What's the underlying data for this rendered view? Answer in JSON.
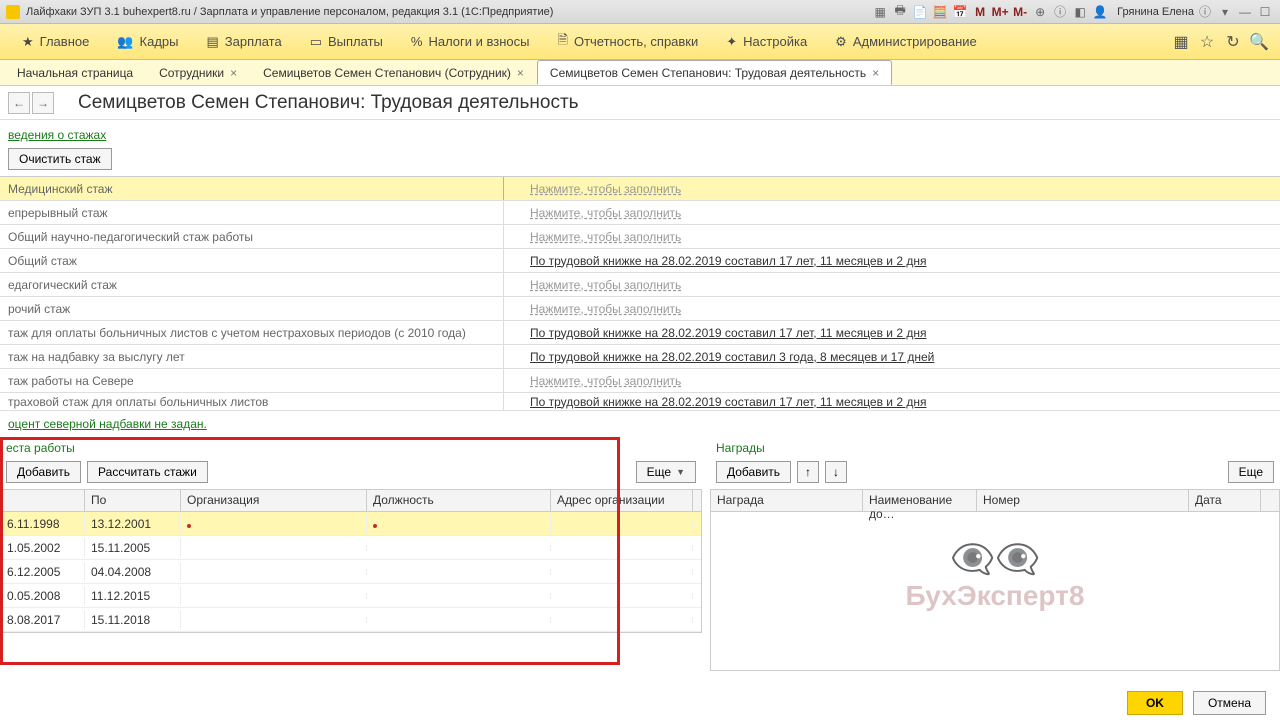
{
  "titlebar": {
    "title": "Лайфхаки ЗУП 3.1 buhexpert8.ru / Зарплата и управление персоналом, редакция 3.1  (1С:Предприятие)",
    "user": "Грянина Елена"
  },
  "menubar": {
    "items": [
      {
        "label": "Главное"
      },
      {
        "label": "Кадры"
      },
      {
        "label": "Зарплата"
      },
      {
        "label": "Выплаты"
      },
      {
        "label": "Налоги и взносы"
      },
      {
        "label": "Отчетность, справки"
      },
      {
        "label": "Настройка"
      },
      {
        "label": "Администрирование"
      }
    ]
  },
  "tabs": {
    "items": [
      {
        "label": "Начальная страница",
        "closable": false
      },
      {
        "label": "Сотрудники",
        "closable": true
      },
      {
        "label": "Семицветов Семен Степанович (Сотрудник)",
        "closable": true
      },
      {
        "label": "Семицветов Семен Степанович: Трудовая деятельность",
        "closable": true,
        "active": true
      }
    ]
  },
  "headline": "Семицветов Семен Степанович: Трудовая деятельность",
  "section1": {
    "title": "ведения о стажах",
    "clear_btn": "Очистить стаж"
  },
  "fill_placeholder": "Нажмите, чтобы заполнить",
  "stazh_rows": [
    {
      "label": "Медицинский стаж",
      "value": "",
      "selected": true
    },
    {
      "label": "епрерывный стаж",
      "value": ""
    },
    {
      "label": "Общий научно-педагогический стаж работы",
      "value": ""
    },
    {
      "label": "Общий стаж",
      "value": "По трудовой книжке на 28.02.2019 составил 17 лет, 11 месяцев и 2 дня"
    },
    {
      "label": "едагогический стаж",
      "value": ""
    },
    {
      "label": "рочий стаж",
      "value": ""
    },
    {
      "label": "таж для оплаты больничных листов с учетом нестраховых периодов (с 2010 года)",
      "value": "По трудовой книжке на 28.02.2019 составил 17 лет, 11 месяцев и 2 дня"
    },
    {
      "label": "таж на надбавку за выслугу лет",
      "value": "По трудовой книжке на 28.02.2019 составил 3 года, 8 месяцев и 17 дней"
    },
    {
      "label": "таж работы на Севере",
      "value": ""
    },
    {
      "label": "траховой стаж для оплаты больничных листов",
      "value": "По трудовой книжке на 28.02.2019 составил 17 лет, 11 месяцев и 2 дня"
    }
  ],
  "northern_link": "оцент северной надбавки не задан.",
  "work_places": {
    "title": "еста работы",
    "add_btn": "Добавить",
    "calc_btn": "Рассчитать стажи",
    "more_btn": "Еще",
    "cols": {
      "s": "",
      "po": "По",
      "org": "Организация",
      "dol": "Должность",
      "addr": "Адрес организации"
    },
    "rows": [
      {
        "s": "6.11.1998",
        "po": "13.12.2001",
        "sel": true,
        "red_org": true,
        "red_dol": true
      },
      {
        "s": "1.05.2002",
        "po": "15.11.2005"
      },
      {
        "s": "6.12.2005",
        "po": "04.04.2008"
      },
      {
        "s": "0.05.2008",
        "po": "11.12.2015"
      },
      {
        "s": "8.08.2017",
        "po": "15.11.2018"
      }
    ]
  },
  "awards": {
    "title": "Награды",
    "add_btn": "Добавить",
    "more_btn": "Еще",
    "cols": {
      "a": "Награда",
      "b": "Наименование до…",
      "c": "Номер",
      "d": "Дата"
    }
  },
  "watermark": "БухЭксперт8",
  "footer": {
    "ok": "OK",
    "cancel": "Отмена"
  }
}
